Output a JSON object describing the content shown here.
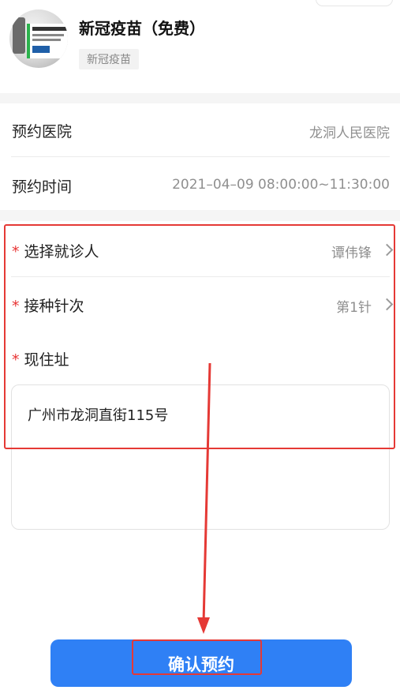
{
  "product": {
    "name": "新冠疫苗（免费）",
    "tag": "新冠疫苗",
    "image_icon": "vaccine-vial-icon"
  },
  "info": {
    "hospital_label": "预约医院",
    "hospital_value": "龙洞人民医院",
    "time_label": "预约时间",
    "time_value": "2021–04–09 08:00:00~11:30:00"
  },
  "form": {
    "required_mark": "*",
    "patient_label": "选择就诊人",
    "patient_value": "谭伟锋",
    "dose_label": "接种针次",
    "dose_value": "第1针",
    "address_label": "现住址",
    "address_value": "广州市龙洞直街115号"
  },
  "actions": {
    "confirm_label": "确认预约"
  },
  "colors": {
    "accent": "#2f80f5",
    "required": "#e83434",
    "annotation": "#e53935"
  }
}
